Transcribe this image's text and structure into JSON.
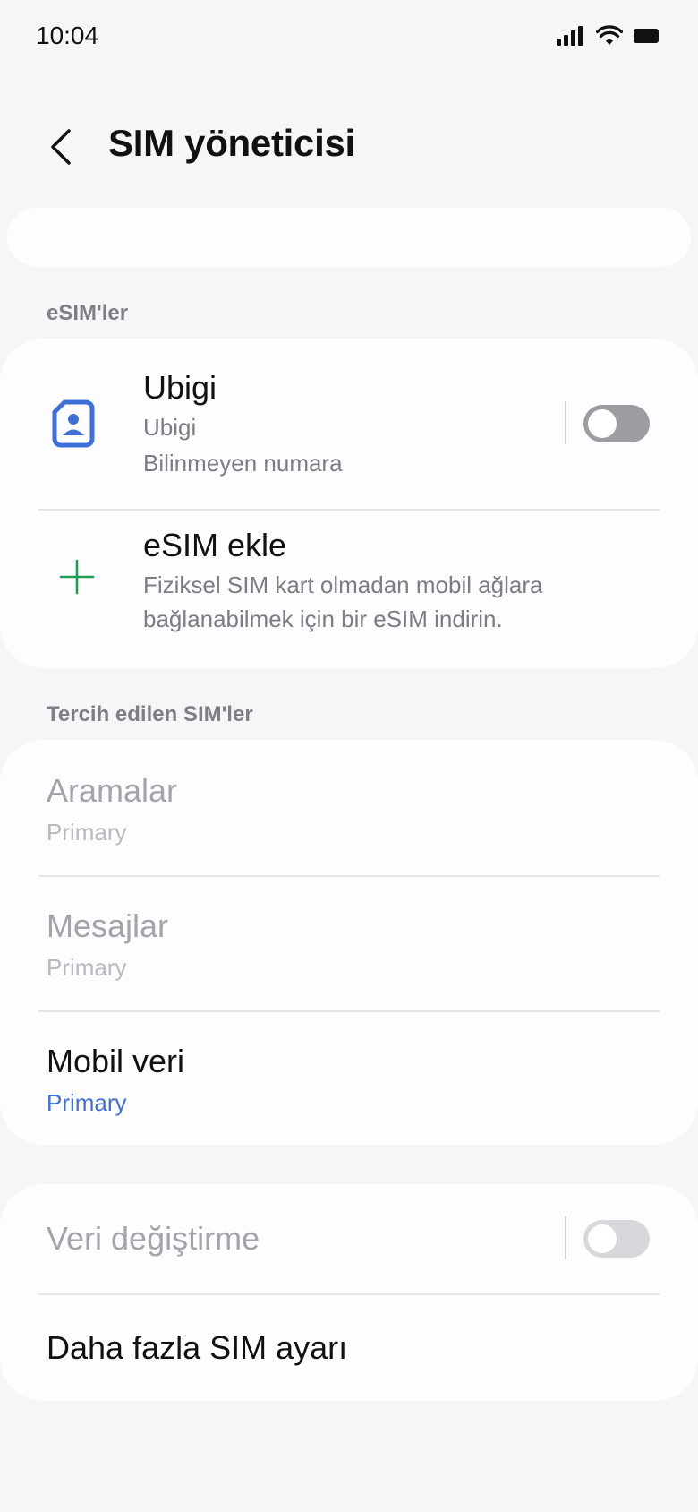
{
  "status_bar": {
    "time": "10:04"
  },
  "header": {
    "title": "SIM yöneticisi"
  },
  "sections": {
    "esims": "eSIM'ler",
    "preferred": "Tercih edilen SIM'ler"
  },
  "esim_card": {
    "ubigi": {
      "name": "Ubigi",
      "carrier": "Ubigi",
      "number": "Bilinmeyen numara",
      "enabled": false
    },
    "add": {
      "title": "eSIM ekle",
      "description_line1": "Fiziksel SIM kart olmadan mobil ağlara",
      "description_line2": "bağlanabilmek için bir eSIM indirin."
    }
  },
  "preferred_card": {
    "calls": {
      "title": "Aramalar",
      "value": "Primary"
    },
    "messages": {
      "title": "Mesajlar",
      "value": "Primary"
    },
    "mobile_data": {
      "title": "Mobil veri",
      "value": "Primary"
    }
  },
  "other_card": {
    "data_switching": {
      "title": "Veri değiştirme",
      "enabled": false
    },
    "more_settings": {
      "title": "Daha fazla SIM ayarı"
    }
  },
  "colors": {
    "accent": "#3f6fd9",
    "add_icon": "#1f9d55",
    "sim_icon": "#3f6fd9"
  }
}
